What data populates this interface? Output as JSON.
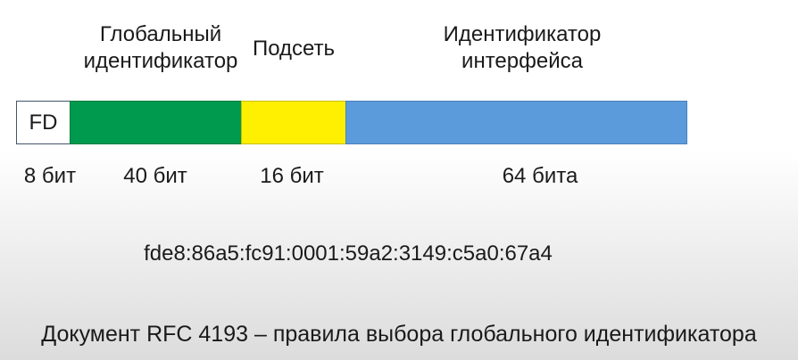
{
  "header_labels": {
    "global_id": [
      "Глобальный",
      "идентификатор"
    ],
    "subnet": "Подсеть",
    "interface_id": [
      "Идентификатор",
      "интерфейса"
    ]
  },
  "segments": {
    "fd": {
      "text": "FD",
      "color": "#ffffff"
    },
    "global_id": {
      "color": "#009a4e"
    },
    "subnet": {
      "color": "#ffef00"
    },
    "interface_id": {
      "color": "#5b9bdc"
    }
  },
  "bit_labels": {
    "fd": "8 бит",
    "global_id": "40 бит",
    "subnet": "16 бит",
    "interface_id": "64 бита"
  },
  "address": "fde8:86a5:fc91:0001:59a2:3149:c5a0:67a4",
  "caption": "Документ RFC 4193 – правила выбора глобального идентификатора"
}
